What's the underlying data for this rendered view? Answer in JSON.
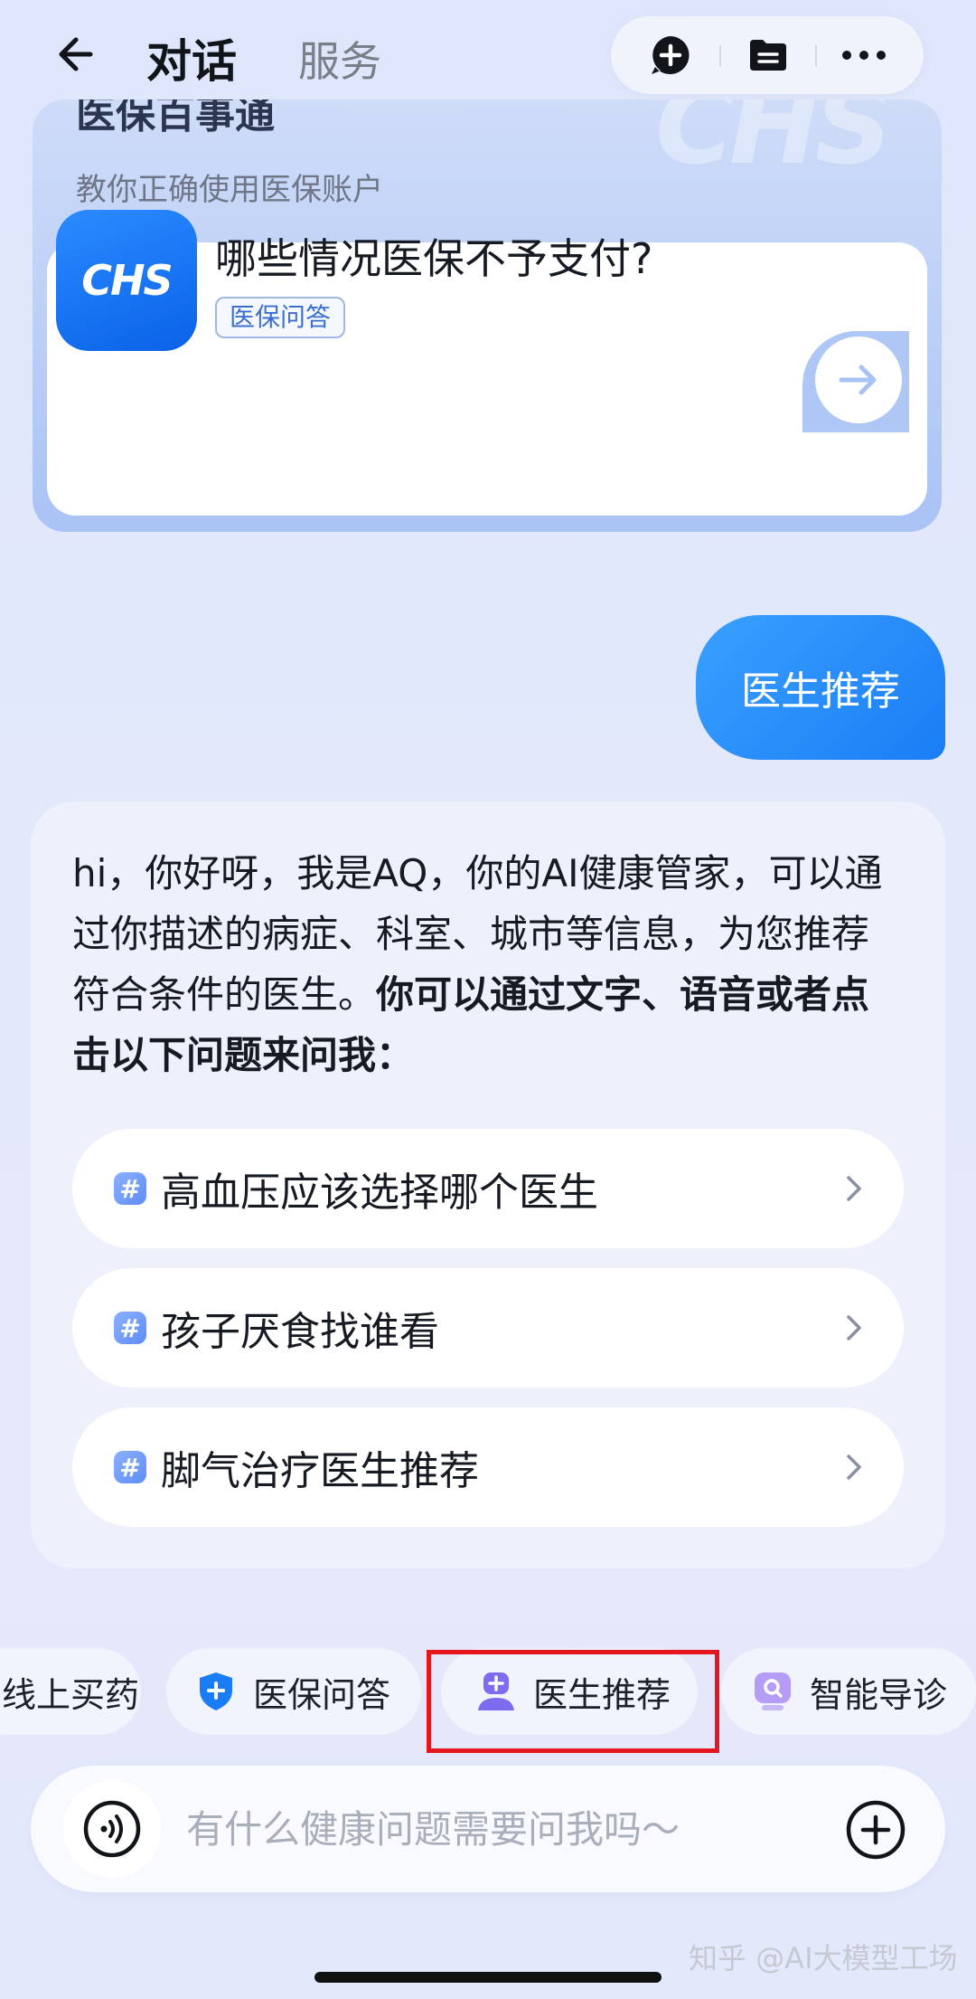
{
  "header": {
    "tab_dialog": "对话",
    "tab_service": "服务",
    "icons": [
      "back-arrow-icon",
      "new-chat-icon",
      "folder-icon",
      "more-icon"
    ]
  },
  "insurance_card": {
    "title": "医保百事通",
    "watermark": "CHS",
    "subtitle": "教你正确使用医保账户",
    "logo_text": "CHS",
    "question": "哪些情况医保不予支付?",
    "tag": "医保问答"
  },
  "user_message": "医生推荐",
  "bot_message": {
    "text_plain": "hi，你好呀，我是AQ，你的AI健康管家，可以通过你描述的病症、科室、城市等信息，为您推荐符合条件的医生。",
    "text_bold": "你可以通过文字、语音或者点击以下问题来问我："
  },
  "suggestions": [
    {
      "label": "高血压应该选择哪个医生"
    },
    {
      "label": "孩子厌食找谁看"
    },
    {
      "label": "脚气治疗医生推荐"
    }
  ],
  "chips": [
    {
      "label": "线上买药"
    },
    {
      "label": "医保问答"
    },
    {
      "label": "医生推荐"
    },
    {
      "label": "智能导诊"
    }
  ],
  "input": {
    "placeholder": "有什么健康问题需要问我吗～",
    "value": ""
  },
  "watermark": "知乎 @AI大模型工场",
  "colors": {
    "accent": "#1a7df5",
    "highlight_border": "#e5171e"
  }
}
